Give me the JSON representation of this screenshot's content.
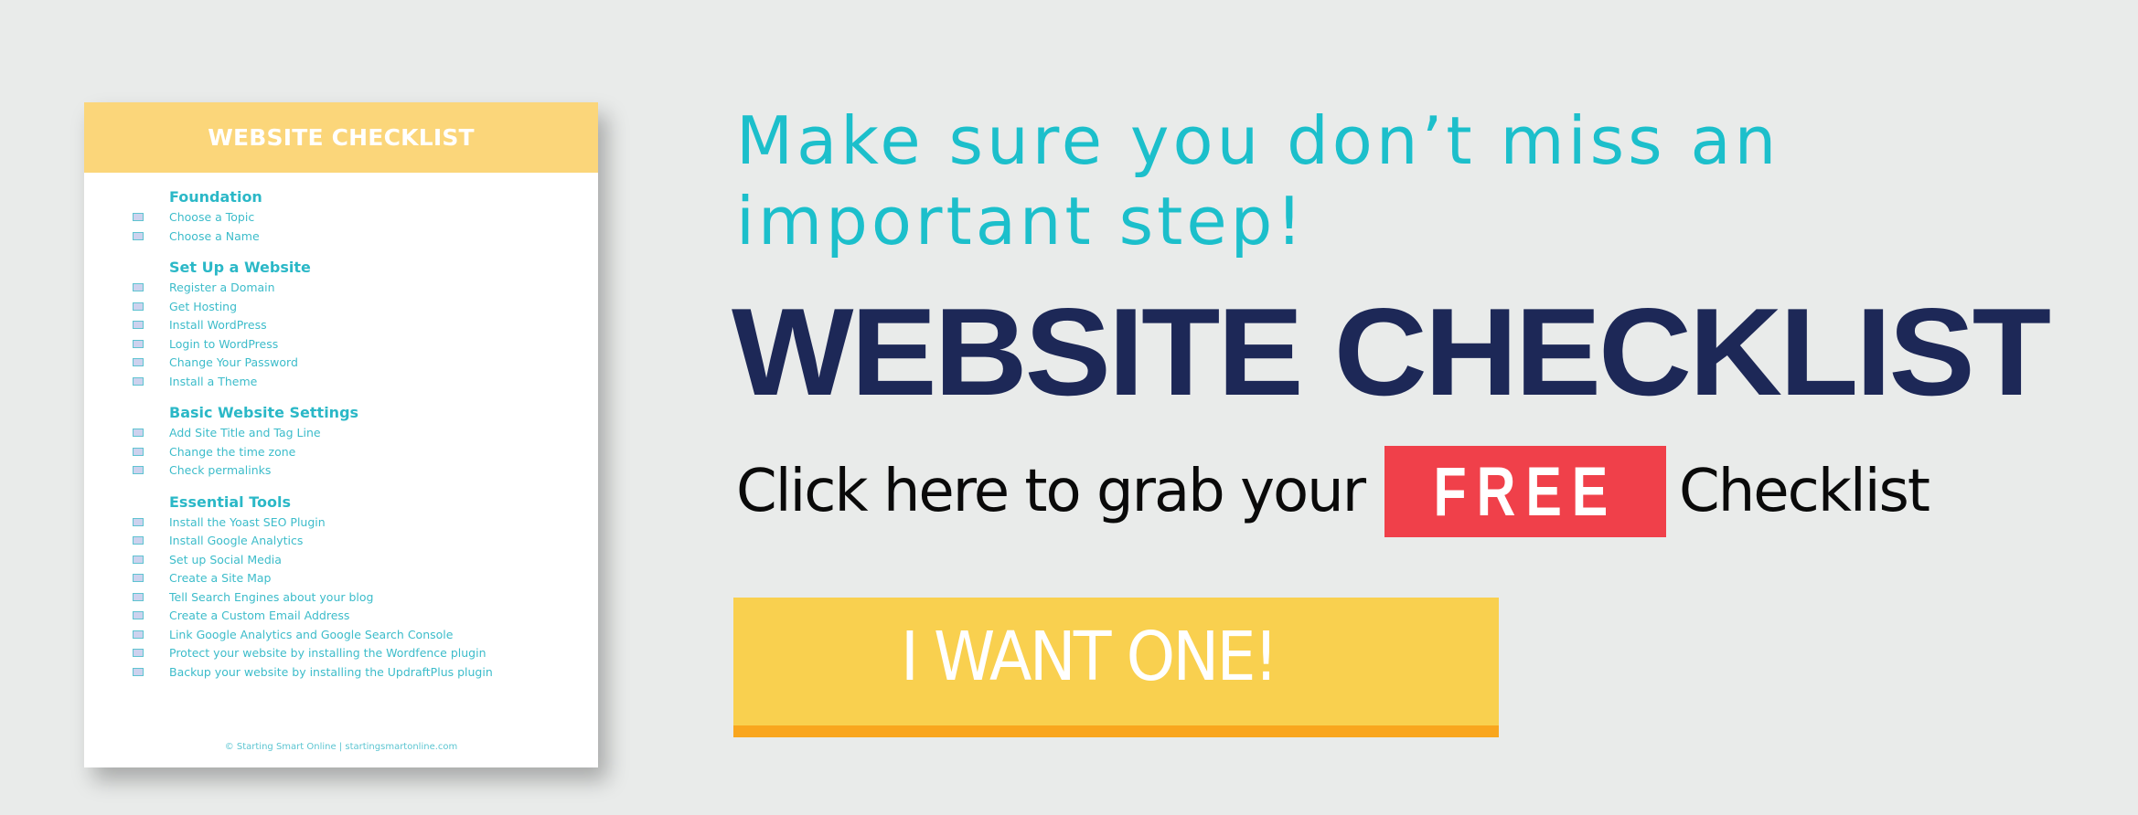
{
  "checklist_preview": {
    "header_title": "WEBSITE CHECKLIST",
    "sections": [
      {
        "title": "Foundation",
        "items": [
          "Choose a Topic",
          "Choose a Name"
        ]
      },
      {
        "title": "Set Up a Website",
        "items": [
          "Register a Domain",
          "Get Hosting",
          "Install WordPress",
          "Login to WordPress",
          "Change Your Password",
          "Install a Theme"
        ]
      },
      {
        "title": "Basic Website Settings",
        "items": [
          "Add Site Title and Tag Line",
          "Change the time zone",
          "Check permalinks"
        ]
      },
      {
        "title": "Essential Tools",
        "items": [
          "Install the Yoast SEO Plugin",
          "Install Google Analytics",
          "Set up Social Media",
          "Create a Site Map",
          "Tell Search Engines about your blog",
          "Create a Custom Email Address",
          "Link Google Analytics and Google Search Console",
          "Protect your website by installing the Wordfence plugin",
          "Backup your website by installing the UpdraftPlus plugin"
        ]
      }
    ],
    "footer": "© Starting Smart Online | startingsmartonline.com",
    "checkbox_icon": "square-checkbox-icon"
  },
  "promo": {
    "tagline_line1": "Make sure you don’t miss an",
    "tagline_line2": "important step!",
    "title": "WEBSITE CHECKLIST",
    "cta_prefix": "Click here to grab your",
    "free_badge": "FREE",
    "cta_suffix": "Checklist",
    "button_label": "I WANT ONE!"
  },
  "colors": {
    "background": "#e9ebea",
    "card_header": "#fbd67a",
    "teal_text": "#1cbfcb",
    "navy_title": "#1d2857",
    "free_red": "#f0404a",
    "button_yellow": "#f9d04f",
    "button_orange_bar": "#f9a61e"
  }
}
